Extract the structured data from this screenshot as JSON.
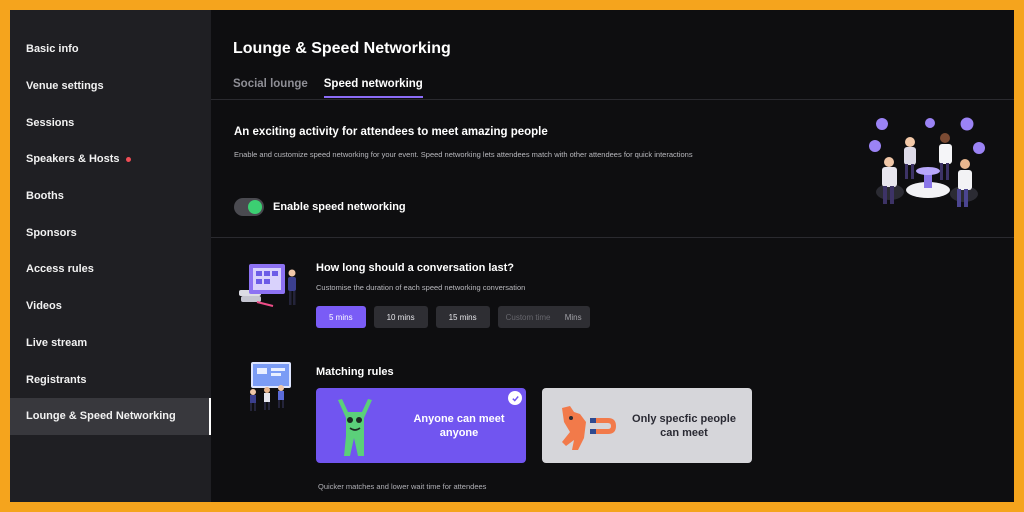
{
  "sidebar": {
    "items": [
      {
        "label": "Basic info"
      },
      {
        "label": "Venue settings"
      },
      {
        "label": "Sessions"
      },
      {
        "label": "Speakers & Hosts"
      },
      {
        "label": "Booths"
      },
      {
        "label": "Sponsors"
      },
      {
        "label": "Access rules"
      },
      {
        "label": "Videos"
      },
      {
        "label": "Live stream"
      },
      {
        "label": "Registrants"
      },
      {
        "label": "Lounge & Speed Networking"
      }
    ],
    "active_index": 10,
    "badge_item_index": 3
  },
  "header": {
    "title": "Lounge & Speed Networking"
  },
  "tabs": [
    {
      "label": "Social lounge",
      "active": false
    },
    {
      "label": "Speed networking",
      "active": true
    }
  ],
  "intro": {
    "title": "An exciting activity for attendees to meet amazing people",
    "description": "Enable and customize speed networking for your event. Speed networking lets attendees match with other attendees for quick interactions",
    "toggle_label": "Enable speed networking",
    "toggle_on": true
  },
  "duration": {
    "title": "How long should a conversation last?",
    "description": "Customise the duration of each speed networking conversation",
    "options": [
      "5 mins",
      "10 mins",
      "15 mins"
    ],
    "selected": "5 mins",
    "custom_placeholder": "Custom time",
    "custom_unit": "Mins"
  },
  "matching": {
    "title": "Matching rules",
    "options": [
      {
        "label": "Anyone can meet anyone",
        "selected": true
      },
      {
        "label": "Only specfic people can meet",
        "selected": false
      }
    ],
    "footnote": "Quicker matches and lower wait time for attendees"
  },
  "colors": {
    "accent": "#7155f0",
    "toggle_on": "#3ccf72",
    "badge": "#ef4d55",
    "frame_border": "#f5a41d"
  }
}
